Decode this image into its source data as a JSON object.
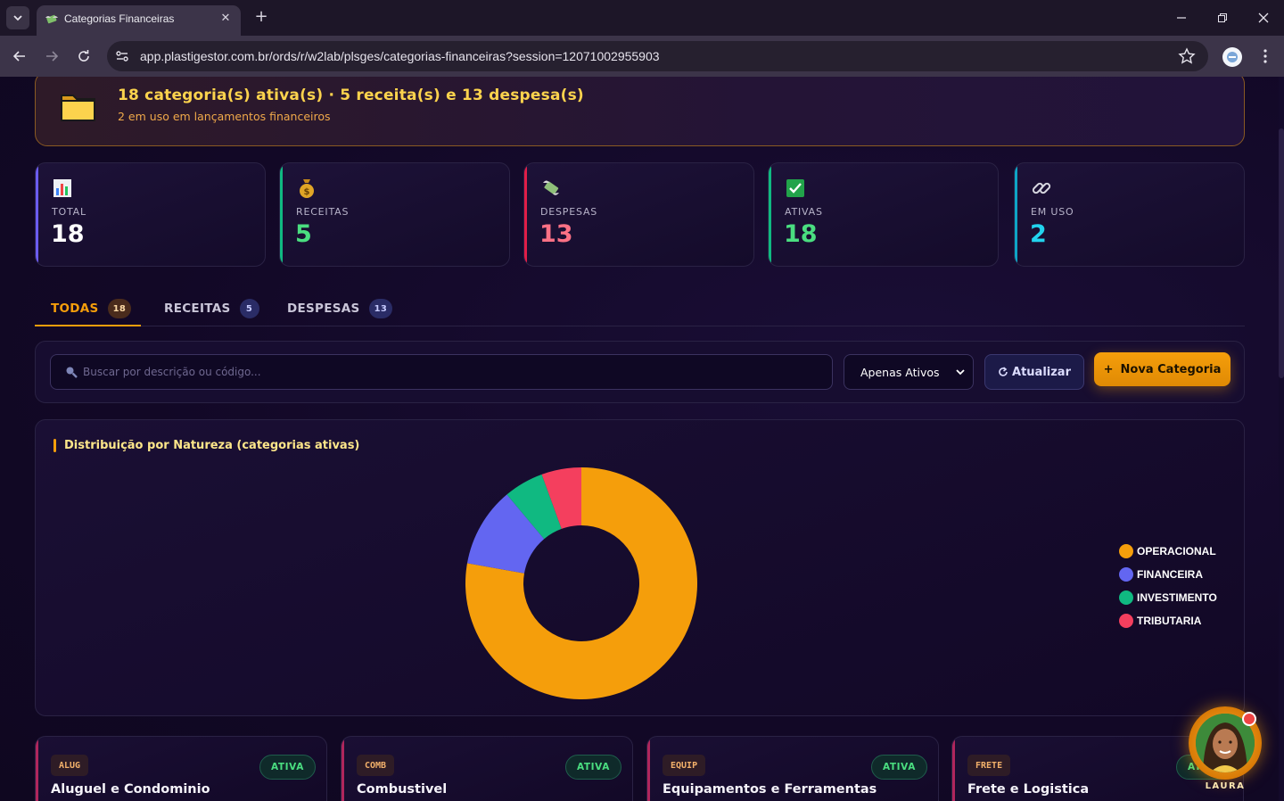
{
  "browser": {
    "tab_title": "Categorias Financeiras",
    "url": "app.plastigestor.com.br/ords/r/w2lab/plsges/categorias-financeiras?session=12071002955903"
  },
  "summary": {
    "title": "18 categoria(s) ativa(s) · 5 receita(s) e 13 despesa(s)",
    "subtitle": "2 em uso em lançamentos financeiros",
    "icon": "folder-icon"
  },
  "kpis": [
    {
      "label": "TOTAL",
      "value": "18",
      "icon": "bar-chart-icon",
      "color": "#ffffff",
      "accent": "#6b5cf0"
    },
    {
      "label": "RECEITAS",
      "value": "5",
      "icon": "money-bag-icon",
      "color": "#4ade80",
      "accent": "#10b981"
    },
    {
      "label": "DESPESAS",
      "value": "13",
      "icon": "money-wings-icon",
      "color": "#fb7185",
      "accent": "#e11d48"
    },
    {
      "label": "ATIVAS",
      "value": "18",
      "icon": "check-icon",
      "color": "#4ade80",
      "accent": "#10b981"
    },
    {
      "label": "EM USO",
      "value": "2",
      "icon": "link-icon",
      "color": "#22d3ee",
      "accent": "#0ea5c6"
    }
  ],
  "filter_tabs": [
    {
      "label": "TODAS",
      "count": "18",
      "active": true
    },
    {
      "label": "RECEITAS",
      "count": "5",
      "active": false
    },
    {
      "label": "DESPESAS",
      "count": "13",
      "active": false
    }
  ],
  "toolbar": {
    "search_placeholder": "Buscar por descrição ou código...",
    "filter_selected": "Apenas Ativos",
    "refresh_label": "Atualizar",
    "refresh_icon": "refresh-icon",
    "new_label": "Nova Categoria",
    "new_icon": "plus-icon"
  },
  "chart_data": {
    "type": "pie",
    "title": "Distribuição por Natureza (categorias ativas)",
    "categories": [
      "OPERACIONAL",
      "FINANCEIRA",
      "INVESTIMENTO",
      "TRIBUTARIA"
    ],
    "values": [
      14,
      2,
      1,
      1
    ],
    "colors": [
      "#f59e0b",
      "#6366f1",
      "#10b981",
      "#f43f5e"
    ],
    "donut": true,
    "legend": "right"
  },
  "categories": [
    {
      "code": "ALUG",
      "name": "Aluguel e Condominio",
      "status": "ATIVA"
    },
    {
      "code": "COMB",
      "name": "Combustivel",
      "status": "ATIVA"
    },
    {
      "code": "EQUIP",
      "name": "Equipamentos e Ferramentas",
      "status": "ATIVA"
    },
    {
      "code": "FRETE",
      "name": "Frete e Logistica",
      "status": "ATIVA"
    }
  ],
  "assistant": {
    "name": "LAURA"
  }
}
